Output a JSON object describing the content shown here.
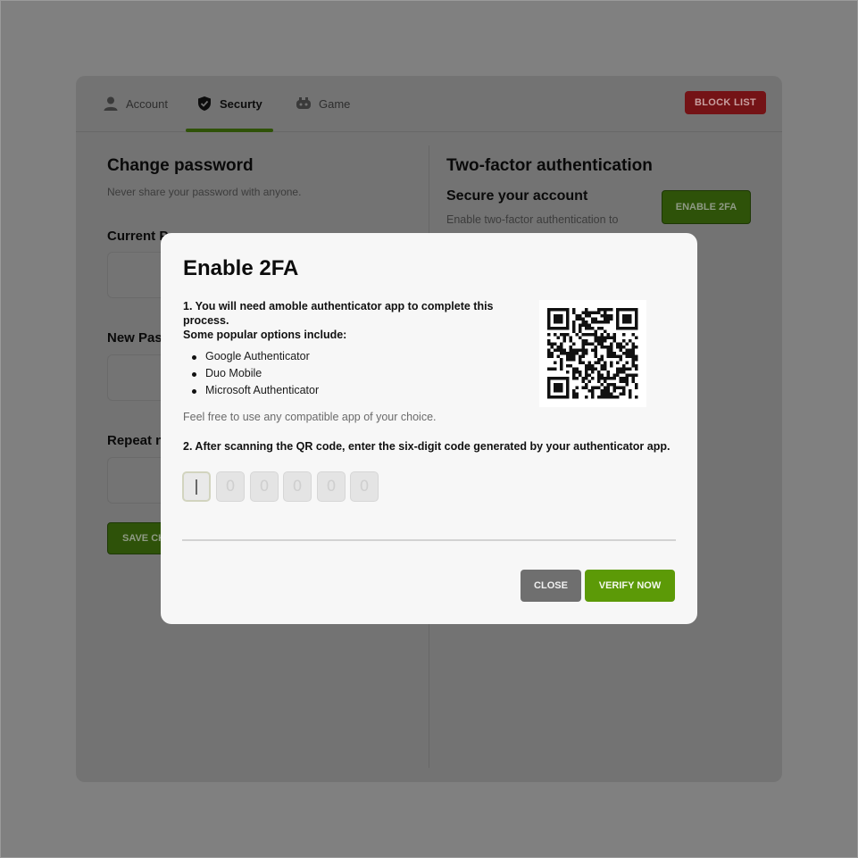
{
  "tabs": {
    "account": "Account",
    "security": "Securty",
    "game": "Game"
  },
  "block_list_label": "BLOCK LIST",
  "change_password": {
    "title": "Change password",
    "subtitle": "Never share your password with anyone.",
    "current_label": "Current P",
    "new_label": "New Pas",
    "repeat_label": "Repeat n",
    "save_label": "SAVE CH"
  },
  "two_factor": {
    "title": "Two-factor authentication",
    "subtitle": "Secure your account",
    "description": "Enable two-factor authentication to",
    "enable_label": "ENABLE 2FA"
  },
  "modal": {
    "title": "Enable 2FA",
    "step1_line1": "1. You will need amoble authenticator app to complete this process.",
    "step1_line2": "Some popular options include:",
    "apps": [
      "Google Authenticator",
      "Duo Mobile",
      "Microsoft Authenticator"
    ],
    "note": "Feel free to use any compatible app of your choice.",
    "step2": "2. After scanning the QR code, enter the six-digit code generated by your authenticator app.",
    "code_placeholders": [
      "|",
      "0",
      "0",
      "0",
      "0",
      "0"
    ],
    "close_label": "CLOSE",
    "verify_label": "VERIFY NOW"
  },
  "colors": {
    "overlay": "#808080",
    "primary_green": "#5c9a07",
    "danger_red": "#741316"
  }
}
